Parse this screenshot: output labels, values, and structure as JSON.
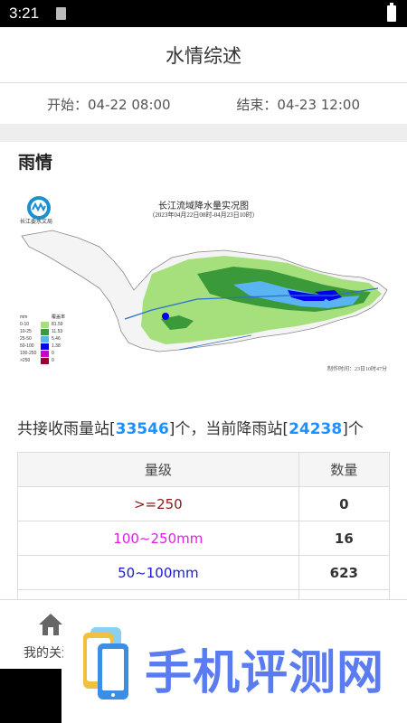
{
  "statusbar": {
    "time": "3:21"
  },
  "header": {
    "title": "水情综述"
  },
  "time_range": {
    "start_label": "开始：04-22 08:00",
    "end_label": "结束：04-23 12:00"
  },
  "rain_section": {
    "title": "雨情"
  },
  "map": {
    "title": "长江流域降水量实况图",
    "subtitle": "（2023年04月22日08时-04月23日10时）",
    "org": "长江委水文局",
    "made_time": "制作时间：23日10时47分",
    "legend_header_unit": "mm",
    "legend_header_pct": "覆盖率",
    "legend": [
      {
        "label": "0-10",
        "color": "#a6e07c",
        "pct": "81.59"
      },
      {
        "label": "10-25",
        "color": "#3a9a3a",
        "pct": "11.53"
      },
      {
        "label": "25-50",
        "color": "#5ab4f0",
        "pct": "5.46"
      },
      {
        "label": "50-100",
        "color": "#0000ee",
        "pct": "1.38"
      },
      {
        "label": "100-250",
        "color": "#cc00cc",
        "pct": "0"
      },
      {
        "label": ">250",
        "color": "#990033",
        "pct": "0"
      }
    ]
  },
  "summary": {
    "prefix": "共接收雨量站[",
    "received": "33546",
    "middle": "]个，当前降雨站[",
    "raining": "24238",
    "suffix": "]个"
  },
  "table": {
    "headers": [
      "量级",
      "数量"
    ],
    "rows": [
      {
        "level": ">=250",
        "count": "0",
        "color": "#8b1a1a"
      },
      {
        "level": "100~250mm",
        "count": "16",
        "color": "#e020e0"
      },
      {
        "level": "50~100mm",
        "count": "623",
        "color": "#1a1acc"
      }
    ]
  },
  "bottom_nav": {
    "item_label": "我的关注"
  },
  "watermark": {
    "text": "手机评测网"
  }
}
